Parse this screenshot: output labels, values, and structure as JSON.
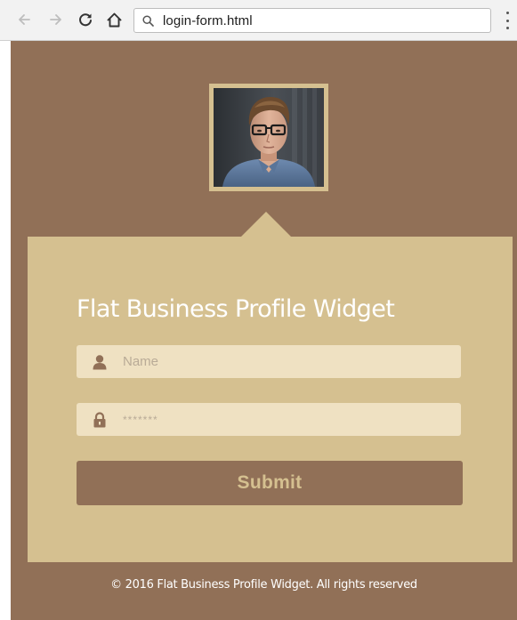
{
  "browser": {
    "address": "login-form.html",
    "icons": {
      "back": "back-arrow-icon",
      "forward": "forward-arrow-icon",
      "reload": "reload-icon",
      "home": "home-icon",
      "search": "search-icon",
      "menu": "more-menu-icon"
    }
  },
  "widget": {
    "title": "Flat Business Profile Widget",
    "name_field": {
      "placeholder": "Name",
      "value": "",
      "icon": "user-icon"
    },
    "password_field": {
      "placeholder": "*******",
      "value": "",
      "icon": "lock-icon"
    },
    "submit_label": "Submit",
    "footer": "© 2016 Flat Business Profile Widget. All rights reserved"
  },
  "colors": {
    "page_background": "#917057",
    "card_background": "#d5c090",
    "input_background": "#efe1c2",
    "button_background": "#917057",
    "button_text": "#d5c090",
    "icon_color": "#917057",
    "title_color": "#ffffff"
  }
}
